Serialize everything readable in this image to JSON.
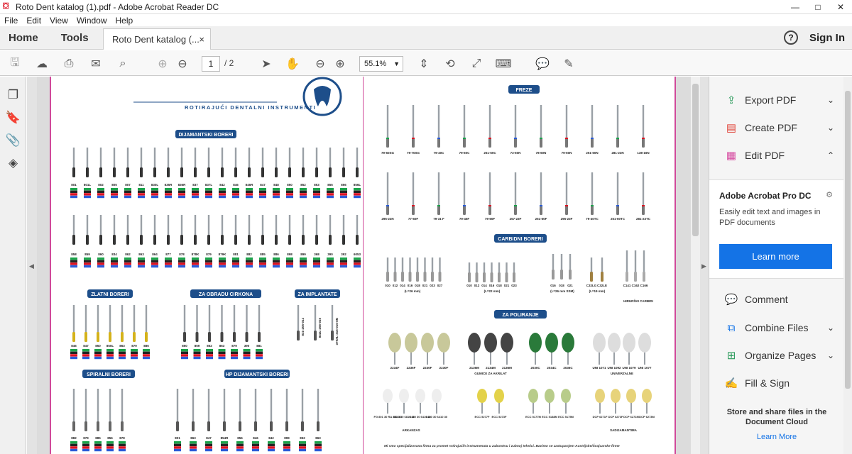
{
  "window": {
    "title": "Roto Dent katalog (1).pdf - Adobe Acrobat Reader DC",
    "controls": [
      "—",
      "□",
      "✕"
    ]
  },
  "menu": [
    "File",
    "Edit",
    "View",
    "Window",
    "Help"
  ],
  "tabs": {
    "home": "Home",
    "tools": "Tools",
    "doc": "Roto Dent katalog (...",
    "close": "×",
    "help": "?",
    "signin": "Sign In"
  },
  "toolbar": {
    "page_current": "1",
    "page_total": "/ 2",
    "zoom": "55.1%"
  },
  "catalog": {
    "title": "ROTIRAJUĆI DENTALNI INSTRUMENTI",
    "sections_left": [
      "DIJAMANTSKI BORERI",
      "ZLATNI BORERI",
      "ZA OBRADU CIRKONA",
      "ZA IMPLANTATE",
      "SPIRALNI BORERI",
      "HP DIJAMANTSKI BORERI"
    ],
    "sections_right": [
      "FREZE",
      "CARBIDNI BORERI",
      "ZA POLIRANJE"
    ],
    "dia_row1": [
      "801",
      "801L",
      "802",
      "805",
      "807",
      "811",
      "830L",
      "835R",
      "836R",
      "837",
      "837L",
      "842",
      "846",
      "846R",
      "847",
      "848",
      "850",
      "852",
      "853",
      "855",
      "856",
      "856L"
    ],
    "dia_row2": [
      "858",
      "859",
      "860",
      "834",
      "862",
      "863",
      "864",
      "877",
      "878",
      "878K",
      "879",
      "879K",
      "881",
      "882",
      "885",
      "886",
      "898",
      "899",
      "368",
      "390",
      "392",
      "6053"
    ],
    "zlatni": [
      "846",
      "847",
      "850",
      "850L",
      "863",
      "879",
      "886"
    ],
    "cirkon": [
      "850",
      "859",
      "862",
      "863",
      "879",
      "390",
      "881"
    ],
    "implant": [
      "831-205-014",
      "832L-256-016",
      "379XL-316-016-8N"
    ],
    "spiralni": [
      "882",
      "879",
      "885",
      "856",
      "878"
    ],
    "hp": [
      "801",
      "863",
      "847",
      "854R",
      "856",
      "846",
      "842",
      "899",
      "852",
      "863"
    ],
    "freze_row1": [
      "79-60SG",
      "79-70SG",
      "79-40C",
      "79-60C",
      "251-60C",
      "73-60N",
      "78-60N",
      "79-60N",
      "251-60N",
      "281-23N",
      "138-16N"
    ],
    "freze_row2": [
      "295-23N",
      "77-60F",
      "79-31 F",
      "79-45F",
      "79-60F",
      "257-23F",
      "251-60F",
      "295-23F",
      "79-40TC",
      "251-60TC",
      "281-23TC"
    ],
    "carbid_g1": [
      "010",
      "012",
      "014",
      "016",
      "018",
      "021",
      "023",
      "027"
    ],
    "carbid_g1_label": "(L=26 mm)",
    "carbid_g2": [
      "010",
      "012",
      "014",
      "016",
      "018",
      "021",
      "023"
    ],
    "carbid_g2_label": "(L=22 mm)",
    "carbid_g3": [
      "016",
      "018",
      "021"
    ],
    "carbid_g3_label": "(L=26 mm SSM)",
    "carbid_g4": [
      "C32LG",
      "C32LE"
    ],
    "carbid_g4_label": "(L=19 mm)",
    "carbid_g5": [
      "C141",
      "C162",
      "C166"
    ],
    "carbid_g5_label": "HIRURŠKI CARBIDI",
    "pol_row1": [
      "2234F",
      "2236F",
      "2230F",
      "2230F",
      "2136M",
      "2134M",
      "2136M",
      "2030C",
      "2034C",
      "2036C",
      "UNI 1071",
      "UNI 1092",
      "UNI 1079",
      "UNI 1077"
    ],
    "pol_row1_labels": [
      "GUMICE ZA AKRILAT",
      "UNIVERZALNE"
    ],
    "pol_row2": [
      "FG 801 30 RA 801 30",
      "6810 30 6810 30",
      "6410 30 6410 30",
      "6410 30 6410 30",
      "ECC 5277F",
      "ECC 5273F",
      "ECC 5177M",
      "ECC 5188M",
      "ECC 5175M",
      "DCP 6271F",
      "DCP 6273F",
      "DCP 6271M",
      "DCP 6273M"
    ],
    "pol_row2_labels": [
      "ARKANZAS",
      "SADIJAMANTIMA"
    ],
    "footer": "Mi smo specijalizovana firma za promet rotirajućih instrumenata u zubarstvu i zubnoj tehnici.  Bavimo se zastupanjem Austrijske/Švajcarske firme"
  },
  "rightpanel": {
    "export": "Export PDF",
    "create": "Create PDF",
    "edit": "Edit PDF",
    "promo_title": "Adobe Acrobat Pro DC",
    "promo_desc": "Easily edit text and images in PDF documents",
    "learn_more": "Learn more",
    "comment": "Comment",
    "combine": "Combine Files",
    "organize": "Organize Pages",
    "fill": "Fill & Sign",
    "store": "Store and share files in the Document Cloud",
    "learn_more2": "Learn More"
  }
}
